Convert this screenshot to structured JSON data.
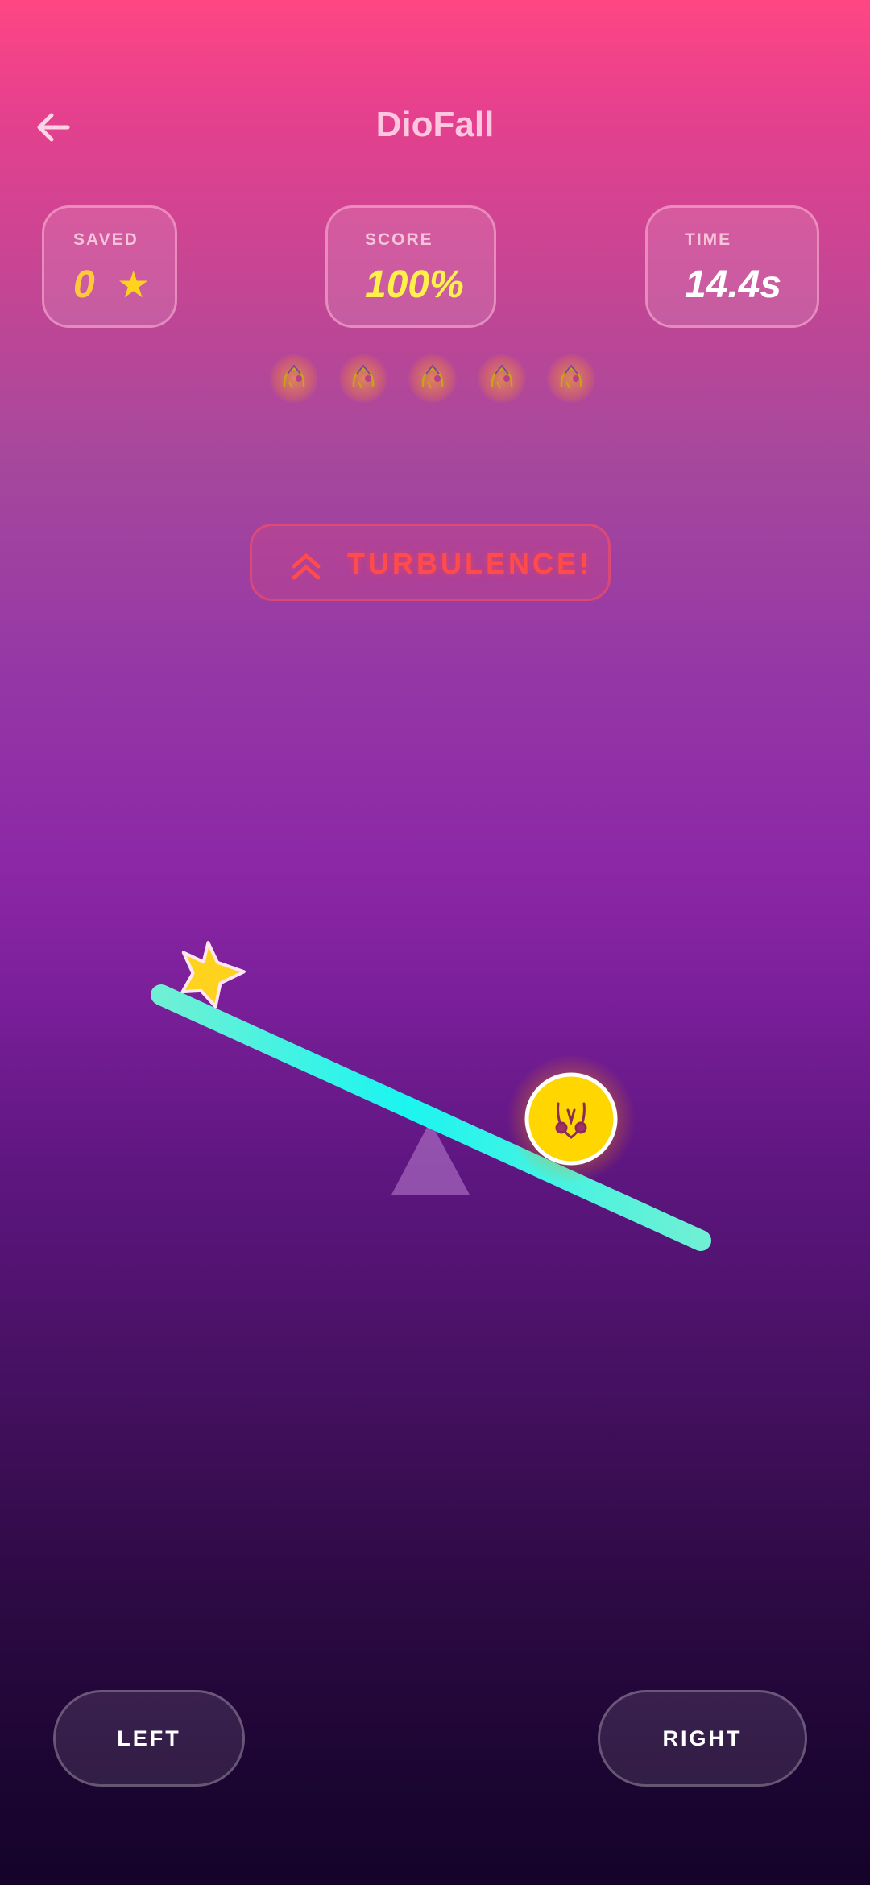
{
  "header": {
    "title": "DioFall",
    "back_icon": "arrow-left-icon"
  },
  "stats": {
    "saved": {
      "label": "SAVED",
      "value": "0",
      "icon": "star-icon"
    },
    "score": {
      "label": "SCORE",
      "value": "100%"
    },
    "time": {
      "label": "TIME",
      "value": "14.4s"
    }
  },
  "lives": {
    "count": 5,
    "icon": "character-icon"
  },
  "banner": {
    "icon": "double-chevron-up-icon",
    "text": "TURBULENCE!"
  },
  "game": {
    "plank_color": "#34f3e4",
    "ball_color": "#ffd600",
    "star_color": "#ffd21e",
    "fulcrum_icon": "triangle-fulcrum"
  },
  "controls": {
    "left_label": "LEFT",
    "right_label": "RIGHT"
  },
  "colors": {
    "accent": "#ff4683",
    "danger": "#ff4b4b"
  }
}
